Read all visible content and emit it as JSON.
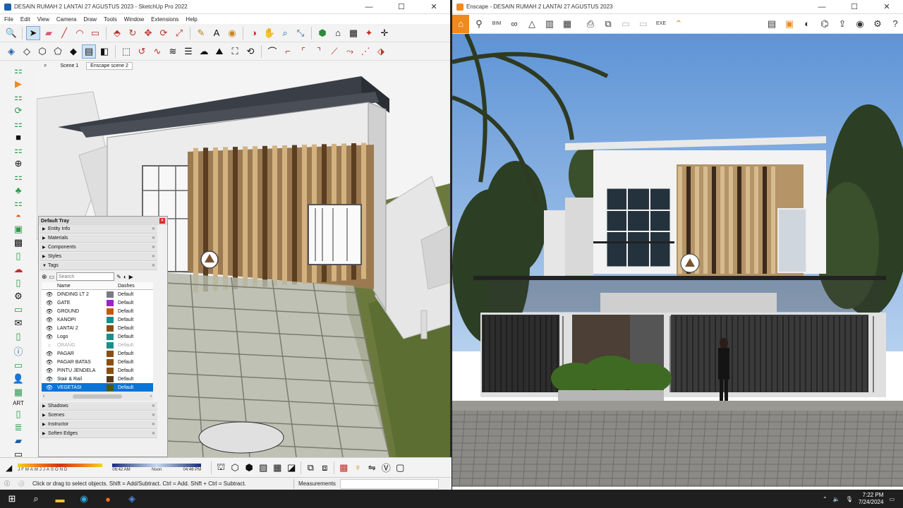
{
  "sketchup": {
    "title": "DESAIN RUMAH 2 LANTAI 27 AGUSTUS 2023 - SketchUp Pro 2022",
    "menu": [
      "File",
      "Edit",
      "View",
      "Camera",
      "Draw",
      "Tools",
      "Window",
      "Extensions",
      "Help"
    ],
    "scenes": [
      "Scene 1",
      "Enscape scene 2"
    ],
    "tray": {
      "title": "Default Tray",
      "panels_top": [
        "Entity Info",
        "Materials",
        "Components",
        "Styles",
        "Tags"
      ],
      "search_placeholder": "Search",
      "columns": {
        "name": "Name",
        "dashes": "Dashes"
      },
      "tags": [
        {
          "name": "DINDING LT 2",
          "color": "#7a7a86",
          "dashes": "Default",
          "visible": true
        },
        {
          "name": "GATE",
          "color": "#a021c8",
          "dashes": "Default",
          "visible": true
        },
        {
          "name": "GROUND",
          "color": "#c25a12",
          "dashes": "Default",
          "visible": true
        },
        {
          "name": "KANOPI",
          "color": "#1a8f8a",
          "dashes": "Default",
          "visible": true
        },
        {
          "name": "LANTAI 2",
          "color": "#8a4e12",
          "dashes": "Default",
          "visible": true
        },
        {
          "name": "Logo",
          "color": "#1a8f8a",
          "dashes": "Default",
          "visible": true
        },
        {
          "name": "ORANG",
          "color": "#1a8f8a",
          "dashes": "Default",
          "visible": false
        },
        {
          "name": "PAGAR",
          "color": "#8a4e12",
          "dashes": "Default",
          "visible": true
        },
        {
          "name": "PAGAR BATAS",
          "color": "#8a4e12",
          "dashes": "Default",
          "visible": true
        },
        {
          "name": "PINTU JENDELA",
          "color": "#8a4e12",
          "dashes": "Default",
          "visible": true
        },
        {
          "name": "Stair & Rail",
          "color": "#5e3a12",
          "dashes": "Default",
          "visible": true
        },
        {
          "name": "VEGETASI",
          "color": "#4e5a12",
          "dashes": "Default",
          "visible": true,
          "selected": true
        }
      ],
      "panels_bottom": [
        "Shadows",
        "Scenes",
        "Instructor",
        "Soften Edges"
      ]
    },
    "shadow_months": [
      "J",
      "F",
      "M",
      "A",
      "M",
      "J",
      "J",
      "A",
      "S",
      "O",
      "N",
      "D"
    ],
    "shadow_time": {
      "start": "06:42 AM",
      "mid": "Noon",
      "end": "04:46 PM"
    },
    "status_text": "Click or drag to select objects. Shift = Add/Subtract. Ctrl = Add. Shift + Ctrl = Subtract.",
    "measurements_label": "Measurements"
  },
  "enscape": {
    "title": "Enscape - DESAIN RUMAH 2 LANTAI 27 AGUSTUS 2023",
    "toolbar_icons": [
      "home-icon",
      "walk-icon",
      "bim-icon",
      "binoculars-icon",
      "nav-icon",
      "buildings-icon",
      "batch-icon",
      "image-export-icon",
      "panorama-icon",
      "video-icon",
      "exe-export-icon",
      "web-icon",
      "settings-icon",
      "help-icon"
    ]
  },
  "taskbar": {
    "time": "7:22 PM",
    "date": "7/24/2024"
  },
  "colors": {
    "accent_orange": "#f08a1c",
    "selection_blue": "#0a74d6",
    "sky": "#6fa3dc"
  }
}
